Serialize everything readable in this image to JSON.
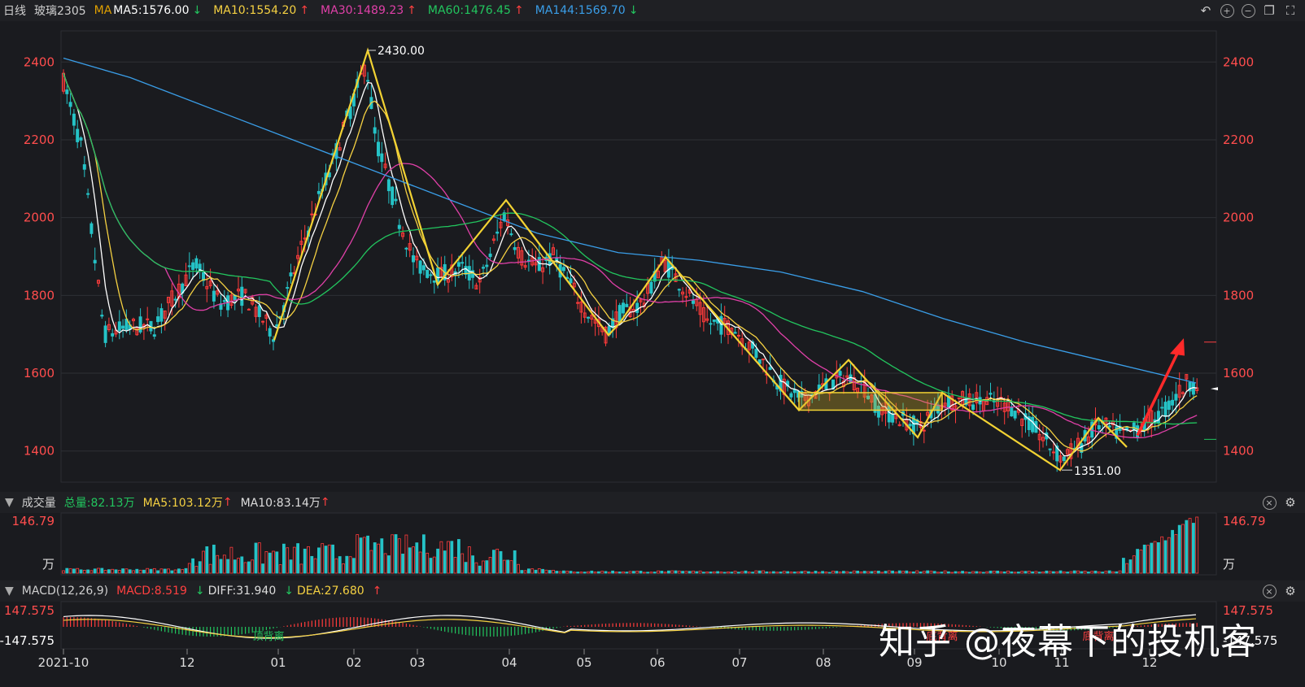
{
  "header": {
    "period": "日线",
    "symbol": "玻璃2305",
    "ma_label": "MA",
    "ma": [
      {
        "text": "MA5:1576.00",
        "arrow": "↓",
        "color": "#ffffff",
        "arrow_color": "#22c55e"
      },
      {
        "text": "MA10:1554.20",
        "arrow": "↑",
        "color": "#f5d142",
        "arrow_color": "#ff4040"
      },
      {
        "text": "MA30:1489.23",
        "arrow": "↑",
        "color": "#e040a8",
        "arrow_color": "#ff4040"
      },
      {
        "text": "MA60:1476.45",
        "arrow": "↑",
        "color": "#22c55e",
        "arrow_color": "#ff4040"
      },
      {
        "text": "MA144:1569.70",
        "arrow": "↓",
        "color": "#3a9ee8",
        "arrow_color": "#22c55e"
      }
    ]
  },
  "toolbar": {
    "icons": [
      "undo-icon",
      "zoom-in-icon",
      "zoom-out-icon",
      "window-icon",
      "fullscreen-icon"
    ]
  },
  "price_panel": {
    "y_ticks": [
      "2400",
      "2200",
      "2000",
      "1800",
      "1600",
      "1400"
    ],
    "high_label": "2430.00",
    "low_label": "1351.00",
    "ylim": [
      1320,
      2480
    ]
  },
  "volume_panel": {
    "title": "成交量",
    "total": "总量:82.13万",
    "ma5": "MA5:103.12万",
    "ma10": "MA10:83.14万",
    "max_tick": "146.79",
    "unit": "万"
  },
  "macd_panel": {
    "title": "MACD(12,26,9)",
    "macd": "MACD:8.519",
    "diff": "DIFF:31.940",
    "dea": "DEA:27.680",
    "top_tick": "147.575",
    "bottom_tick": "-147.575",
    "annotations": [
      {
        "text": "顶背离",
        "color": "#22c55e",
        "month": "01"
      },
      {
        "text": "底背离",
        "color": "#ff4040",
        "month": "09"
      },
      {
        "text": "底背离",
        "color": "#ff4040",
        "month": "11"
      }
    ]
  },
  "x_axis": [
    "2021-10",
    "12",
    "01",
    "02",
    "03",
    "04",
    "05",
    "06",
    "07",
    "08",
    "09",
    "10",
    "11",
    "12"
  ],
  "watermark": "知乎 @夜幕下的投机客",
  "colors": {
    "up": "#ff3b3b",
    "down": "#25c3c7",
    "ma5": "#ffffff",
    "ma10": "#f5d142",
    "ma30": "#e040a8",
    "ma60": "#22c55e",
    "ma144": "#3a9ee8",
    "zigzag": "#f2d233"
  }
}
